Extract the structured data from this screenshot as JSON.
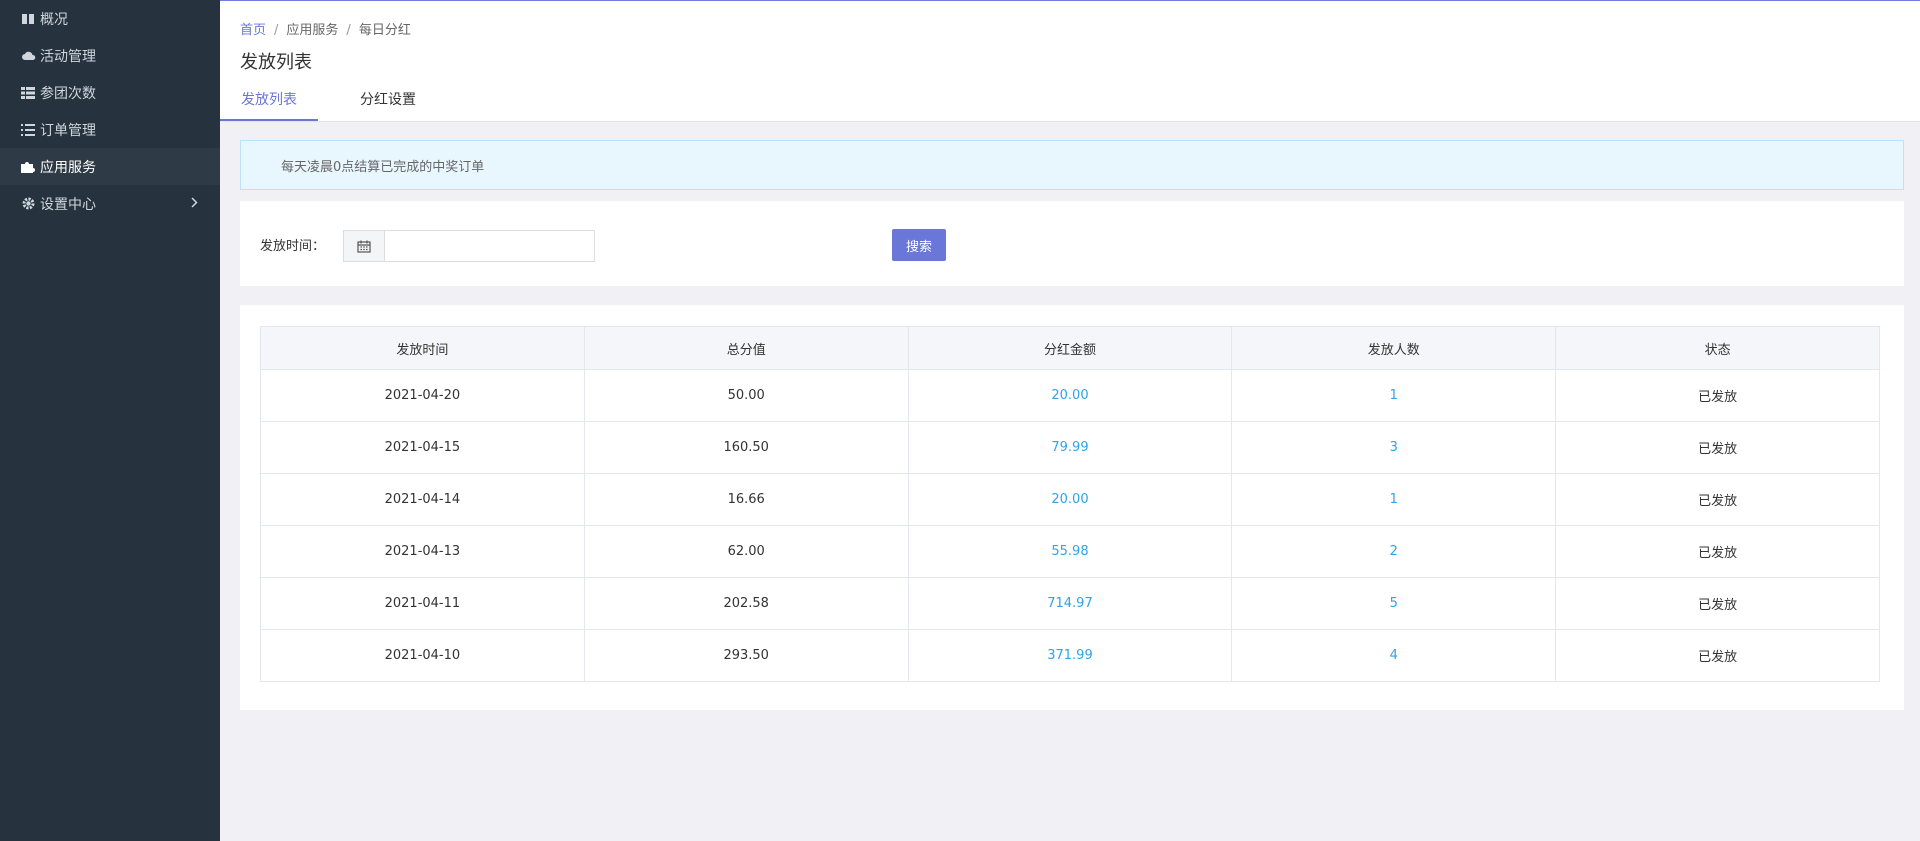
{
  "sidebar": {
    "items": [
      {
        "label": "概况",
        "icon": "book-icon"
      },
      {
        "label": "活动管理",
        "icon": "cloud-icon"
      },
      {
        "label": "参团次数",
        "icon": "th-list-icon"
      },
      {
        "label": "订单管理",
        "icon": "list-icon"
      },
      {
        "label": "应用服务",
        "icon": "puzzle-icon",
        "active": true
      },
      {
        "label": "设置中心",
        "icon": "gear-icon",
        "has_children": true
      }
    ]
  },
  "breadcrumb": {
    "home": "首页",
    "level2": "应用服务",
    "current": "每日分红"
  },
  "page": {
    "title": "发放列表"
  },
  "tabs": [
    {
      "label": "发放列表",
      "active": true
    },
    {
      "label": "分红设置",
      "active": false
    }
  ],
  "alert": {
    "text": "每天凌晨0点结算已完成的中奖订单"
  },
  "search": {
    "date_label": "发放时间：",
    "date_value": "",
    "button_label": "搜索"
  },
  "table": {
    "headers": [
      "发放时间",
      "总分值",
      "分红金额",
      "发放人数",
      "状态"
    ],
    "rows": [
      [
        "2021-04-20",
        "50.00",
        "20.00",
        "1",
        "已发放"
      ],
      [
        "2021-04-15",
        "160.50",
        "79.99",
        "3",
        "已发放"
      ],
      [
        "2021-04-14",
        "16.66",
        "20.00",
        "1",
        "已发放"
      ],
      [
        "2021-04-13",
        "62.00",
        "55.98",
        "2",
        "已发放"
      ],
      [
        "2021-04-11",
        "202.58",
        "714.97",
        "5",
        "已发放"
      ],
      [
        "2021-04-10",
        "293.50",
        "371.99",
        "4",
        "已发放"
      ]
    ]
  },
  "colors": {
    "accent": "#6a76d8",
    "link_blue": "#2fa4e7",
    "sidebar_bg": "#26323d",
    "alert_bg": "#e8f6fd"
  }
}
